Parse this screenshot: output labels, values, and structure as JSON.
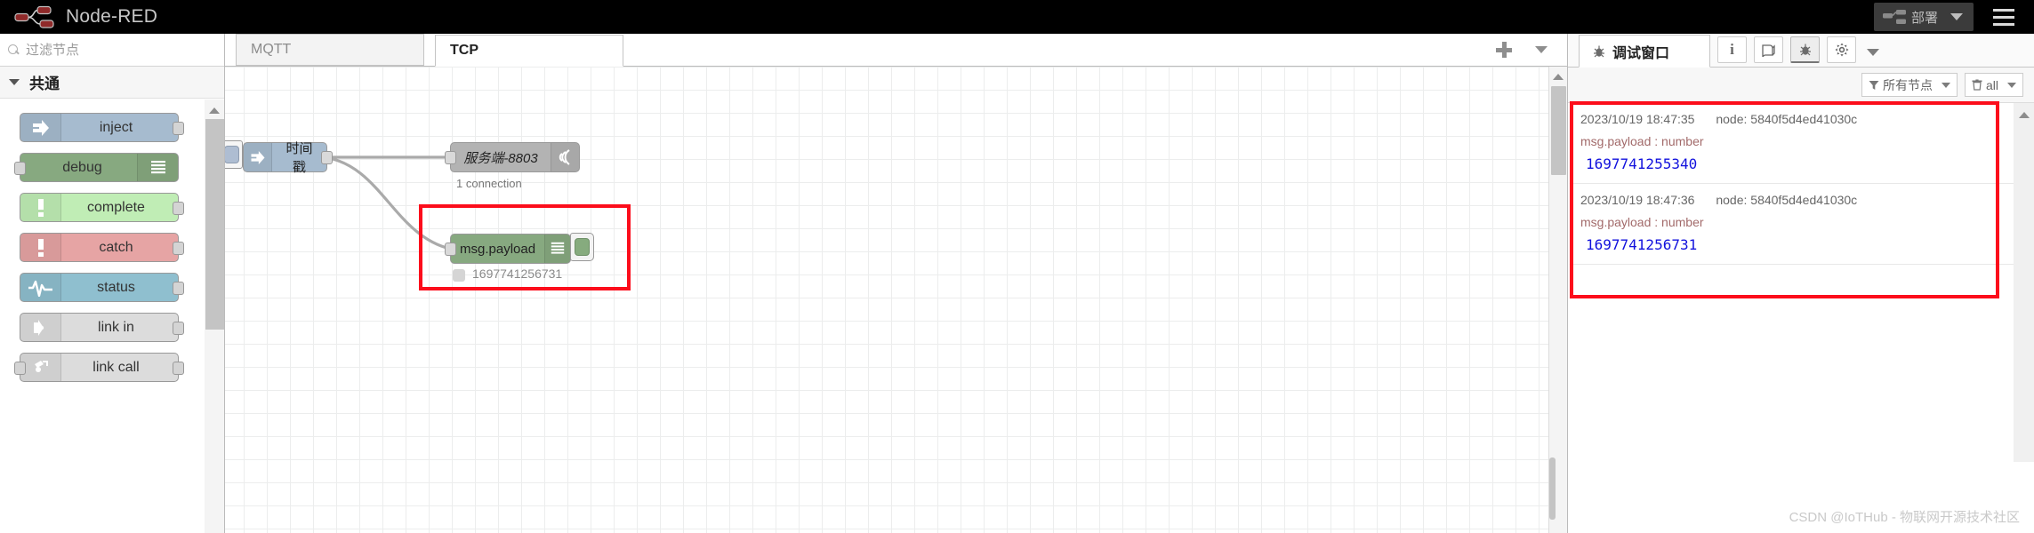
{
  "header": {
    "brand_title": "Node-RED",
    "logo_icon": "node-red-logo-icon",
    "deploy_label": "部署",
    "deploy_icon": "deploy-node-icon",
    "deploy_caret_icon": "chevron-down-icon",
    "menu_icon": "hamburger-menu-icon"
  },
  "palette": {
    "search_placeholder": "过滤节点",
    "search_value": "",
    "search_icon": "search-icon",
    "category": {
      "label": "共通",
      "chevron_icon": "chevron-down-icon",
      "expanded": true
    },
    "nodes": [
      {
        "label": "inject",
        "icon": "inject-arrow-icon",
        "bg": "#a6bbcf",
        "icon_side": "left",
        "port_out": true,
        "port_in": false
      },
      {
        "label": "debug",
        "icon": "debug-lines-icon",
        "bg": "#87a980",
        "icon_side": "right",
        "port_out": false,
        "port_in": true
      },
      {
        "label": "complete",
        "icon": "exclamation-icon",
        "bg": "#c0edb5",
        "icon_side": "left",
        "port_out": true,
        "port_in": false
      },
      {
        "label": "catch",
        "icon": "exclamation-icon",
        "bg": "#e6a4a4",
        "icon_side": "left",
        "port_out": true,
        "port_in": false
      },
      {
        "label": "status",
        "icon": "pulse-wave-icon",
        "bg": "#8fbfcf",
        "icon_side": "left",
        "port_out": true,
        "port_in": false
      },
      {
        "label": "link in",
        "icon": "link-in-icon",
        "bg": "#dcdcdc",
        "icon_side": "left",
        "port_out": true,
        "port_in": false
      },
      {
        "label": "link call",
        "icon": "link-call-icon",
        "bg": "#dcdcdc",
        "icon_side": "left",
        "port_out": true,
        "port_in": true
      }
    ],
    "scrollbar": {
      "up_arrow_icon": "caret-up-icon"
    }
  },
  "tabs": {
    "items": [
      {
        "label": "MQTT",
        "active": false
      },
      {
        "label": "TCP",
        "active": true
      }
    ],
    "add_icon": "plus-icon",
    "more_icon": "chevron-down-icon"
  },
  "flow": {
    "nodes": [
      {
        "label": "时间戳",
        "type": "inject",
        "bg": "#a6bbcf",
        "icon": "inject-arrow-icon",
        "has_inject_button": true,
        "status": ""
      },
      {
        "label": "服务端-8803",
        "type": "tcp-out",
        "bg": "#b3b3b3",
        "icon": "broadcast-icon",
        "status": "1 connection"
      },
      {
        "label": "msg.payload",
        "type": "debug",
        "bg": "#87a980",
        "icon": "debug-lines-icon",
        "status": "1697741256731",
        "enabled": true
      }
    ],
    "highlight_color": "#fc0d1b",
    "scrollbar": {
      "up_arrow_icon": "caret-up-icon"
    }
  },
  "sidebar": {
    "tab_label": "调试窗口",
    "tab_icon": "bug-icon",
    "icon_buttons": [
      {
        "name": "info-icon",
        "glyph": "i",
        "selected": false
      },
      {
        "name": "help-book-icon",
        "glyph": "▤",
        "selected": false
      },
      {
        "name": "bug-icon",
        "glyph": "🐞",
        "selected": true
      },
      {
        "name": "gear-icon",
        "glyph": "✿",
        "selected": false
      }
    ],
    "more_icon": "chevron-down-icon",
    "filter": {
      "label": "所有节点",
      "icon": "filter-funnel-icon",
      "caret_icon": "chevron-down-icon"
    },
    "clear": {
      "label": "all",
      "icon": "trash-icon",
      "caret_icon": "chevron-down-icon"
    },
    "messages": [
      {
        "timestamp": "2023/10/19 18:47:35",
        "node": "node: 5840f5d4ed41030c",
        "topic": "msg.payload : number",
        "value": "1697741255340"
      },
      {
        "timestamp": "2023/10/19 18:47:36",
        "node": "node: 5840f5d4ed41030c",
        "topic": "msg.payload : number",
        "value": "1697741256731"
      }
    ],
    "highlight_color": "#fc0d1b",
    "scrollbar": {
      "up_arrow_icon": "caret-up-icon"
    }
  },
  "watermark": "CSDN @IoTHub - 物联网开源技术社区"
}
